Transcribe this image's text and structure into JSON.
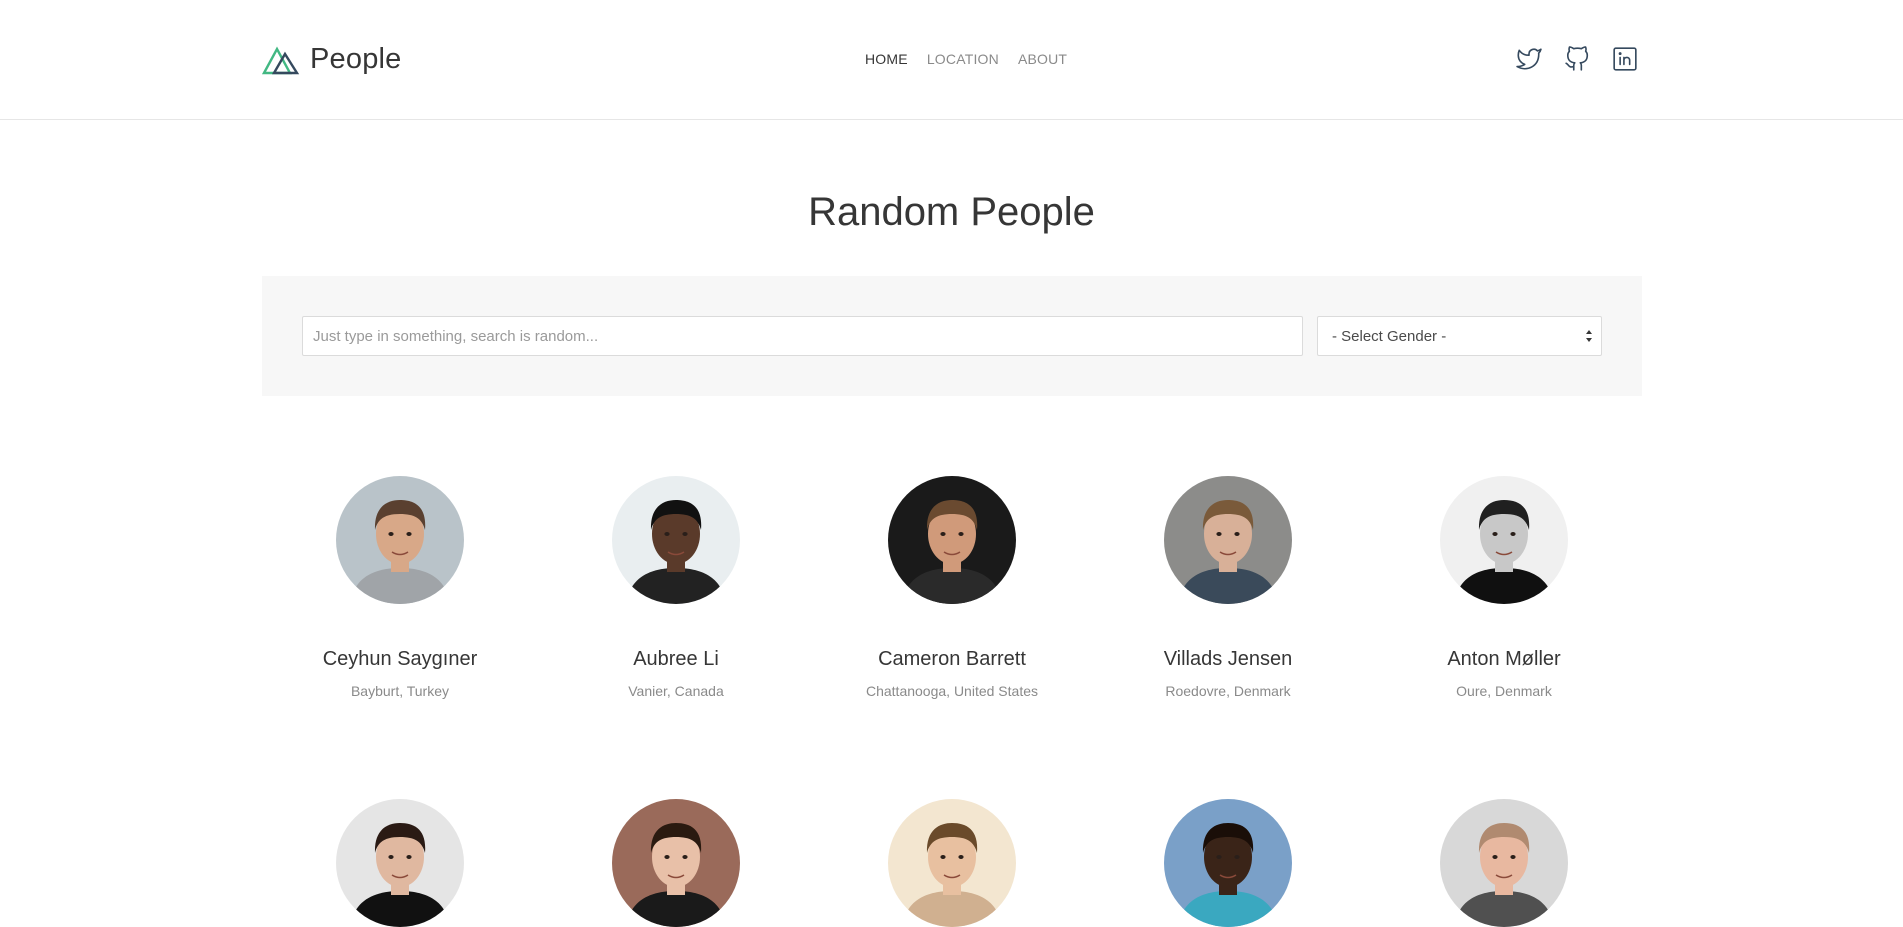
{
  "brand": {
    "name": "People",
    "accent_colors": [
      "#42b883",
      "#35495e"
    ]
  },
  "nav": {
    "items": [
      {
        "label": "HOME",
        "active": true
      },
      {
        "label": "LOCATION",
        "active": false
      },
      {
        "label": "ABOUT",
        "active": false
      }
    ]
  },
  "socials": [
    {
      "icon": "twitter-icon"
    },
    {
      "icon": "github-icon"
    },
    {
      "icon": "linkedin-icon"
    }
  ],
  "page": {
    "title": "Random People"
  },
  "search": {
    "placeholder": "Just type in something, search is random...",
    "value": "",
    "gender_select": "- Select Gender -"
  },
  "people": [
    {
      "name": "Ceyhun Saygıner",
      "location": "Bayburt, Turkey",
      "bg": "#b9c3c9",
      "skin": "#d8a888",
      "hair": "#5a4030",
      "shirt": "#a0a4a8"
    },
    {
      "name": "Aubree Li",
      "location": "Vanier, Canada",
      "bg": "#e9eef0",
      "skin": "#5a3a2a",
      "hair": "#111111",
      "shirt": "#222222"
    },
    {
      "name": "Cameron Barrett",
      "location": "Chattanooga, United States",
      "bg": "#1a1a1a",
      "skin": "#d09a7a",
      "hair": "#6a4a30",
      "shirt": "#2a2a2a"
    },
    {
      "name": "Villads Jensen",
      "location": "Roedovre, Denmark",
      "bg": "#8c8c8a",
      "skin": "#d8b098",
      "hair": "#7a5a3a",
      "shirt": "#3a4a5a"
    },
    {
      "name": "Anton Møller",
      "location": "Oure, Denmark",
      "bg": "#f0f0f0",
      "skin": "#c8c8c8",
      "hair": "#202020",
      "shirt": "#101010"
    },
    {
      "name": "",
      "location": "",
      "bg": "#e5e5e5",
      "skin": "#e0b8a0",
      "hair": "#2a1a14",
      "shirt": "#111111"
    },
    {
      "name": "",
      "location": "",
      "bg": "#9a6a5a",
      "skin": "#e8c0a8",
      "hair": "#2a1a10",
      "shirt": "#1a1a1a"
    },
    {
      "name": "",
      "location": "",
      "bg": "#f3e6d0",
      "skin": "#e8c0a0",
      "hair": "#6a4a2a",
      "shirt": "#d0b090"
    },
    {
      "name": "",
      "location": "",
      "bg": "#7aa0c8",
      "skin": "#3a2418",
      "hair": "#1a0e08",
      "shirt": "#3aa8c0"
    },
    {
      "name": "",
      "location": "",
      "bg": "#d8d8d8",
      "skin": "#e8b8a0",
      "hair": "#b08a70",
      "shirt": "#505050"
    }
  ]
}
